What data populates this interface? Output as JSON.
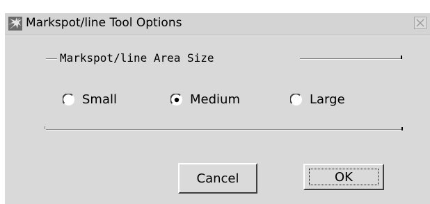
{
  "window": {
    "title": "Markspot/line Tool Options",
    "icon": "tool-icon",
    "close": "close-icon"
  },
  "group": {
    "label": "Markspot/line Area Size"
  },
  "options": [
    {
      "label": "Small",
      "selected": false
    },
    {
      "label": "Medium",
      "selected": true
    },
    {
      "label": "Large",
      "selected": false
    }
  ],
  "buttons": {
    "cancel": "Cancel",
    "ok": "OK"
  }
}
